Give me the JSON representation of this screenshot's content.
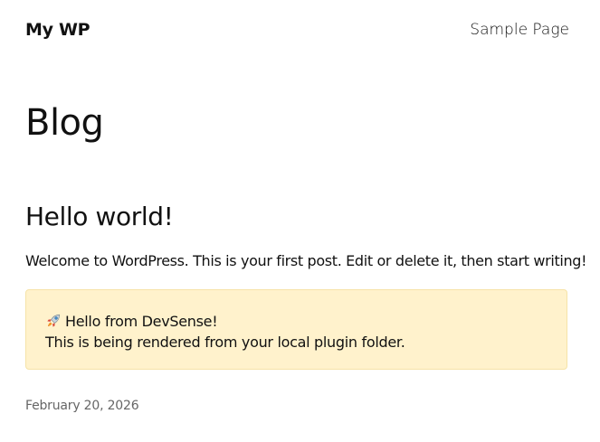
{
  "header": {
    "site_title": "My WP",
    "nav": [
      {
        "label": "Sample Page"
      }
    ]
  },
  "main": {
    "page_title": "Blog",
    "posts": [
      {
        "title": "Hello world!",
        "excerpt": "Welcome to WordPress. This is your first post. Edit or delete it, then start writing!",
        "notice": {
          "icon": "rocket-icon",
          "heading": "Hello from DevSense!",
          "message": "This is being rendered from your local plugin folder.",
          "background_color": "#fff2cc"
        },
        "date": "February 20, 2026"
      }
    ]
  }
}
